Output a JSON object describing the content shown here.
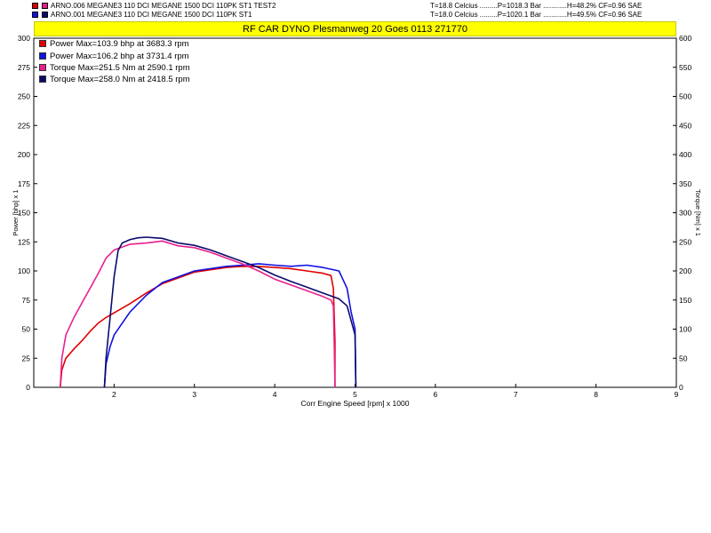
{
  "header": {
    "runs": [
      {
        "label": "ARNO.006 MEGANE3 110 DCI    MEGANE 1500 DCI 110PK ST1 TEST2",
        "conditions": "T=18.8 Celcius .........P=1018.3 Bar ............H=48.2% CF=0.96 SAE",
        "colors": [
          "#e00000",
          "#e8208c"
        ]
      },
      {
        "label": "ARNO.001 MEGANE3 110 DCI    MEGANE 1500 DCI 110PK ST1",
        "conditions": "T=18.0 Celcius .........P=1020.1 Bar ............H=49.5% CF=0.96 SAE",
        "colors": [
          "#1010e0",
          "#0a0a6e"
        ]
      }
    ],
    "title": "RF CAR DYNO  Plesmanweg 20 Goes  0113 271770"
  },
  "chart_data": {
    "type": "line",
    "xlabel": "Corr Engine Speed [rpm] x 1000",
    "ylabel_left": "Power [bhp] x 1",
    "ylabel_right": "Torque [Nm] x 1",
    "xlim": [
      1,
      9
    ],
    "ylim_left": [
      0,
      300
    ],
    "ylim_right": [
      0,
      600
    ],
    "x_ticks": [
      2,
      3,
      4,
      5,
      6,
      7,
      8,
      9
    ],
    "y_ticks_left": [
      0,
      25,
      50,
      75,
      100,
      125,
      150,
      175,
      200,
      225,
      250,
      275,
      300
    ],
    "y_ticks_right": [
      0,
      50,
      100,
      150,
      200,
      250,
      300,
      350,
      400,
      450,
      500,
      550,
      600
    ],
    "grid": false,
    "legend_position": "top-left",
    "legend": [
      {
        "label": "Power  Max=103.9 bhp at 3683.3 rpm",
        "color": "#e00000"
      },
      {
        "label": "Power  Max=106.2 bhp at 3731.4 rpm",
        "color": "#1010e0"
      },
      {
        "label": "Torque  Max=251.5 Nm at 2590.1 rpm",
        "color": "#e8208c"
      },
      {
        "label": "Torque  Max=258.0 Nm at 2418.5 rpm",
        "color": "#0a0a6e"
      }
    ],
    "series": [
      {
        "axis": "left",
        "color": "#e00000",
        "x": [
          1.33,
          1.35,
          1.4,
          1.5,
          1.6,
          1.7,
          1.8,
          1.9,
          2.0,
          2.2,
          2.4,
          2.6,
          2.8,
          3.0,
          3.2,
          3.4,
          3.6,
          3.8,
          4.0,
          4.2,
          4.4,
          4.6,
          4.7,
          4.73,
          4.75,
          4.75
        ],
        "y": [
          0,
          15,
          25,
          33,
          40,
          48,
          55,
          60,
          64,
          72,
          81,
          89,
          94,
          99,
          101,
          103,
          104,
          103.9,
          103,
          102,
          100,
          98,
          96,
          85,
          40,
          0
        ]
      },
      {
        "axis": "left",
        "color": "#1010e0",
        "x": [
          1.88,
          1.9,
          1.95,
          2.0,
          2.1,
          2.2,
          2.4,
          2.6,
          2.8,
          3.0,
          3.2,
          3.4,
          3.6,
          3.8,
          4.0,
          4.2,
          4.4,
          4.6,
          4.8,
          4.9,
          4.95,
          5.0,
          5.01
        ],
        "y": [
          0,
          20,
          35,
          45,
          55,
          65,
          79,
          90,
          95,
          100,
          102,
          104,
          105,
          106.2,
          105,
          104,
          105,
          103,
          100,
          85,
          65,
          50,
          0
        ]
      },
      {
        "axis": "right",
        "color": "#e8208c",
        "x": [
          1.33,
          1.35,
          1.4,
          1.5,
          1.6,
          1.7,
          1.8,
          1.9,
          2.0,
          2.2,
          2.4,
          2.6,
          2.8,
          3.0,
          3.2,
          3.4,
          3.6,
          3.8,
          4.0,
          4.2,
          4.4,
          4.6,
          4.7,
          4.73,
          4.74,
          4.75
        ],
        "y": [
          0,
          50,
          90,
          120,
          145,
          170,
          195,
          222,
          236,
          246,
          248,
          251.5,
          243,
          240,
          232,
          222,
          212,
          200,
          186,
          176,
          166,
          156,
          150,
          140,
          80,
          0
        ]
      },
      {
        "axis": "right",
        "color": "#0a0a6e",
        "x": [
          1.88,
          1.9,
          1.95,
          2.0,
          2.05,
          2.1,
          2.2,
          2.3,
          2.4,
          2.5,
          2.6,
          2.8,
          3.0,
          3.2,
          3.4,
          3.6,
          3.8,
          4.0,
          4.2,
          4.4,
          4.6,
          4.8,
          4.9,
          4.95,
          5.0,
          5.01
        ],
        "y": [
          0,
          50,
          120,
          190,
          235,
          248,
          254,
          257,
          258,
          257,
          256,
          248,
          244,
          236,
          226,
          216,
          206,
          193,
          182,
          172,
          162,
          152,
          140,
          115,
          90,
          0
        ]
      }
    ]
  }
}
